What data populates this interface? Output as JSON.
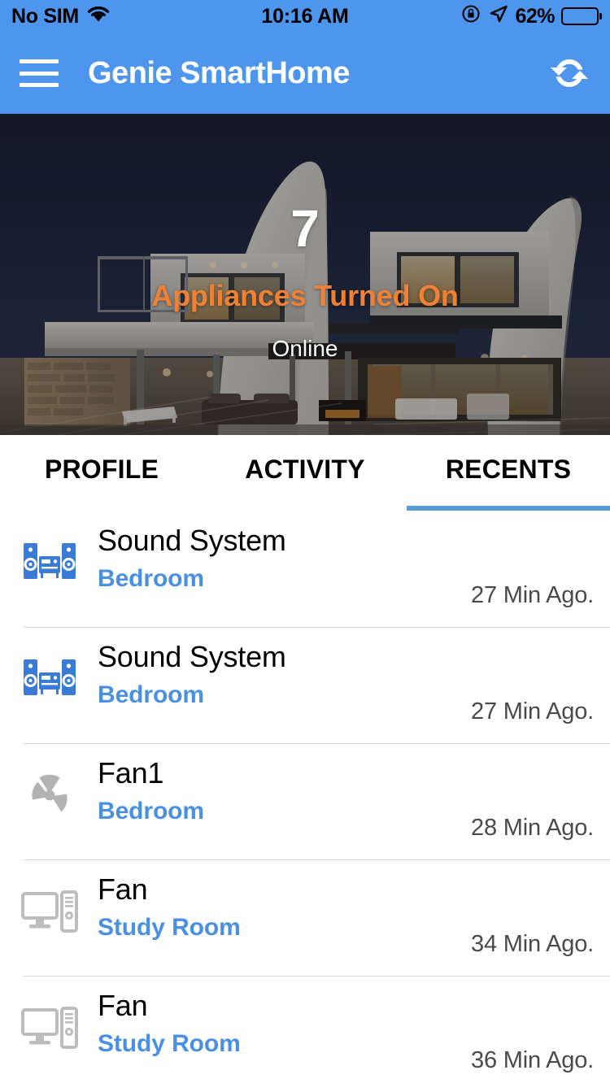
{
  "status_bar": {
    "carrier": "No SIM",
    "wifi_icon": "wifi-icon",
    "time": "10:16 AM",
    "rotation_lock_icon": "rotation-lock-icon",
    "location_icon": "location-arrow-icon",
    "battery_percent": "62%",
    "battery_level": 62,
    "battery_icon": "battery-icon"
  },
  "app_bar": {
    "menu_icon": "hamburger-menu-icon",
    "title": "Genie SmartHome",
    "refresh_icon": "refresh-icon",
    "background_color": "#4d95ed"
  },
  "hero": {
    "count": "7",
    "subtitle": "Appliances Turned On",
    "status": "Online",
    "subtitle_color": "#ee8136",
    "count_color": "#ffffff",
    "image_description": "modern-house-at-dusk"
  },
  "tabs": [
    {
      "label": "PROFILE",
      "active": false
    },
    {
      "label": "ACTIVITY",
      "active": false
    },
    {
      "label": "RECENTS",
      "active": true
    }
  ],
  "tab_indicator_color": "#5b9bd5",
  "recents": [
    {
      "icon": "sound-system-icon",
      "icon_color": "#3a7bd5",
      "title": "Sound System",
      "room": "Bedroom",
      "time": "27 Min Ago."
    },
    {
      "icon": "sound-system-icon",
      "icon_color": "#3a7bd5",
      "title": "Sound System",
      "room": "Bedroom",
      "time": "27 Min Ago."
    },
    {
      "icon": "fan-blades-icon",
      "icon_color": "#b3b3b3",
      "title": "Fan1",
      "room": "Bedroom",
      "time": "28 Min Ago."
    },
    {
      "icon": "desktop-computer-icon",
      "icon_color": "#bdbdbd",
      "title": "Fan",
      "room": "Study Room",
      "time": "34 Min Ago."
    },
    {
      "icon": "desktop-computer-icon",
      "icon_color": "#bdbdbd",
      "title": "Fan",
      "room": "Study Room",
      "time": "36 Min Ago."
    }
  ],
  "colors": {
    "accent_blue": "#4a90e2",
    "room_blue": "#4a90e2",
    "orange": "#ee8136",
    "divider": "#d8d8d8"
  }
}
